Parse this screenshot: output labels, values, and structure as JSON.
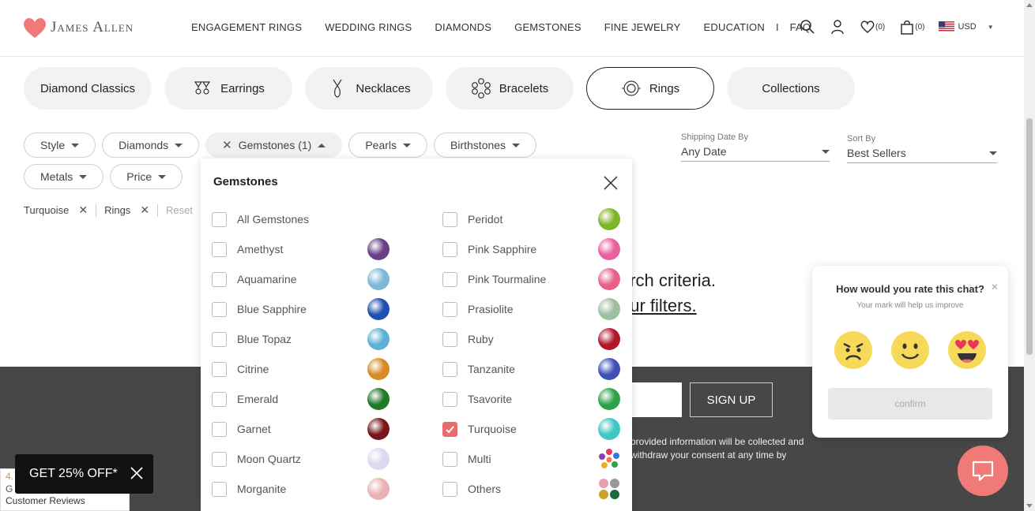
{
  "brand": {
    "name": "James Allen",
    "accent": "#f07a78"
  },
  "nav": [
    "ENGAGEMENT RINGS",
    "WEDDING RINGS",
    "DIAMONDS",
    "GEMSTONES",
    "FINE JEWELRY",
    "EDUCATION"
  ],
  "nav_sep": "I",
  "nav_faq": "FAQ",
  "header": {
    "wishlist_count": "(0)",
    "cart_count": "(0)",
    "currency": "USD"
  },
  "categories": [
    {
      "label": "Diamond Classics",
      "icon": ""
    },
    {
      "label": "Earrings",
      "icon": "earrings-icon"
    },
    {
      "label": "Necklaces",
      "icon": "necklace-icon"
    },
    {
      "label": "Bracelets",
      "icon": "bracelet-icon"
    },
    {
      "label": "Rings",
      "icon": "ring-icon",
      "active": true
    },
    {
      "label": "Collections",
      "icon": ""
    }
  ],
  "filters": {
    "style": "Style",
    "diamonds": "Diamonds",
    "gemstones": "Gemstones (1)",
    "pearls": "Pearls",
    "birthstones": "Birthstones",
    "metals": "Metals",
    "price": "Price"
  },
  "shipping": {
    "label": "Shipping Date By",
    "value": "Any Date"
  },
  "sort": {
    "label": "Sort By",
    "value": "Best Sellers"
  },
  "chips": {
    "turquoise": "Turquoise",
    "rings": "Rings",
    "reset": "Reset"
  },
  "no_results": {
    "line1": "arch criteria.",
    "line2": "our filters."
  },
  "panel": {
    "title": "Gemstones",
    "left": [
      {
        "label": "All Gemstones",
        "color": "",
        "checked": false
      },
      {
        "label": "Amethyst",
        "color": "#6b3f8a",
        "checked": false
      },
      {
        "label": "Aquamarine",
        "color": "#7fb8d6",
        "checked": false
      },
      {
        "label": "Blue Sapphire",
        "color": "#1f4fb0",
        "checked": false
      },
      {
        "label": "Blue Topaz",
        "color": "#5fb0d8",
        "checked": false
      },
      {
        "label": "Citrine",
        "color": "#d88a25",
        "checked": false
      },
      {
        "label": "Emerald",
        "color": "#1f7a2a",
        "checked": false
      },
      {
        "label": "Garnet",
        "color": "#7a1518",
        "checked": false
      },
      {
        "label": "Moon Quartz",
        "color": "#dcd8ee",
        "checked": false
      },
      {
        "label": "Morganite",
        "color": "#eab0b4",
        "checked": false
      }
    ],
    "right": [
      {
        "label": "Peridot",
        "color": "#7fb52a",
        "checked": false
      },
      {
        "label": "Pink Sapphire",
        "color": "#e8619e",
        "checked": false
      },
      {
        "label": "Pink Tourmaline",
        "color": "#e8608a",
        "checked": false
      },
      {
        "label": "Prasiolite",
        "color": "#9dbf9e",
        "checked": false
      },
      {
        "label": "Ruby",
        "color": "#b0182a",
        "checked": false
      },
      {
        "label": "Tanzanite",
        "color": "#3e4fb8",
        "checked": false
      },
      {
        "label": "Tsavorite",
        "color": "#2ea24a",
        "checked": false
      },
      {
        "label": "Turquoise",
        "color": "#3ec7c4",
        "checked": true
      },
      {
        "label": "Multi",
        "color": "multi",
        "checked": false
      },
      {
        "label": "Others",
        "color": "others",
        "checked": false
      }
    ]
  },
  "newsletter": {
    "signup": "SIGN UP",
    "consent1": "provided information will be collected and",
    "consent2": "withdraw your consent at any time by"
  },
  "rating": {
    "title": "How would you rate this chat?",
    "subtitle": "Your mark will help us improve",
    "confirm": "confirm"
  },
  "promo": {
    "label": "GET 25% OFF*"
  },
  "reviews": {
    "score": "4.",
    "g": "G",
    "text": "Customer Reviews"
  }
}
